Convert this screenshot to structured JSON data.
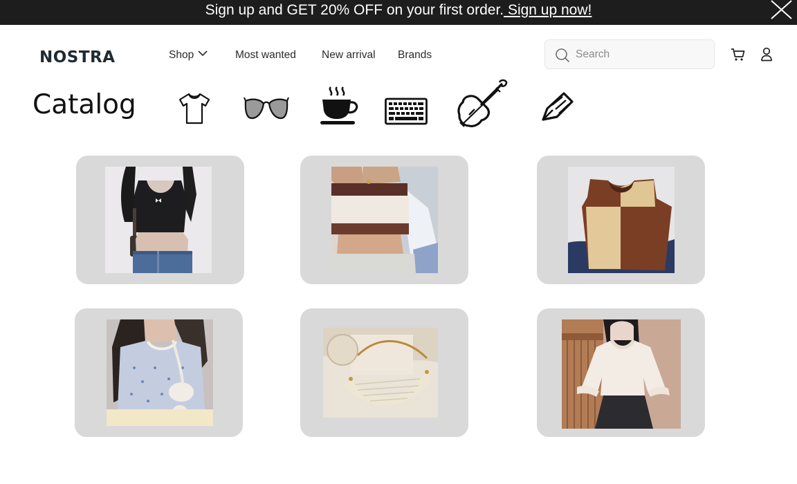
{
  "promo": {
    "text": "Sign up and GET 20% OFF on your first order.",
    "link": " Sign up now!"
  },
  "header": {
    "logo": "NOSTRA",
    "nav": {
      "shop": "Shop",
      "most_wanted": "Most wanted",
      "new_arrival": "New arrival",
      "brands": "Brands"
    },
    "search": {
      "placeholder": "Search"
    }
  },
  "catalog": {
    "title": "Catalog",
    "categories": [
      "tshirt-icon",
      "sunglasses-icon",
      "coffee-cup-icon",
      "keyboard-icon",
      "violin-icon",
      "pen-nib-icon"
    ]
  },
  "products": [
    {
      "icon": "black-crop-top-photo"
    },
    {
      "icon": "knit-crop-top-photo"
    },
    {
      "icon": "knit-vest-photo"
    },
    {
      "icon": "floral-cardigan-photo"
    },
    {
      "icon": "cream-shoulder-bag-photo"
    },
    {
      "icon": "ruffle-blouse-photo"
    }
  ],
  "colors": {
    "promo_bg": "#1d1d1d",
    "card_bg": "#d9d9d9"
  }
}
